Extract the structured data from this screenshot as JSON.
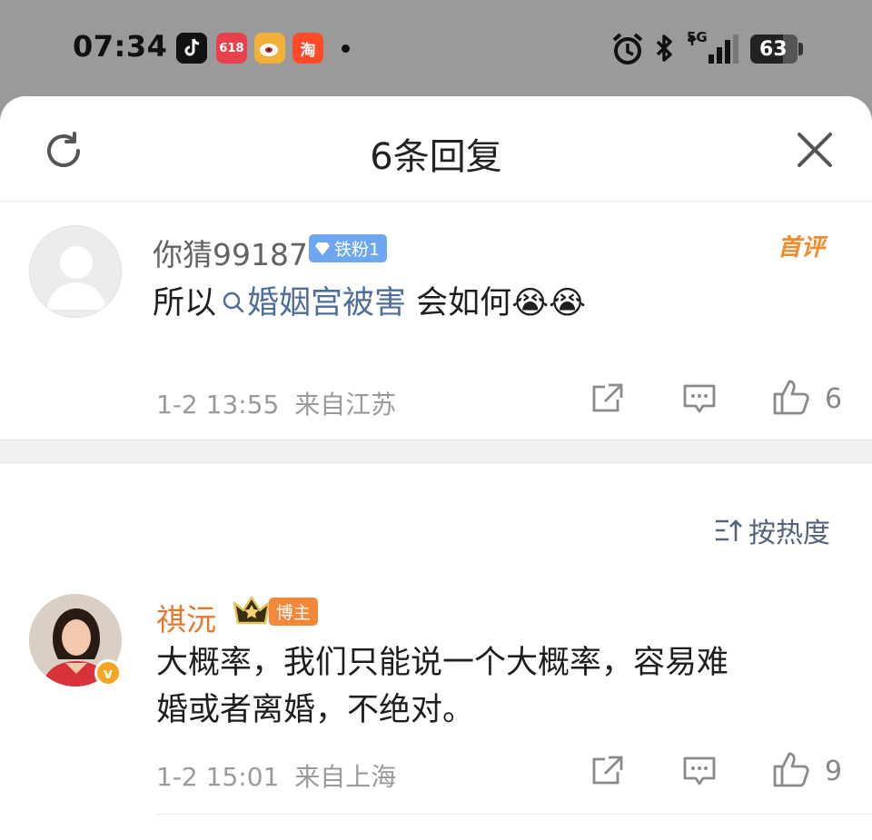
{
  "status_bar": {
    "time": "07:34",
    "apps": [
      {
        "name": "tiktok-icon",
        "label": "♪",
        "color": "#111111"
      },
      {
        "name": "618-app-icon",
        "label": "618",
        "color": "#e8414c"
      },
      {
        "name": "weibo-icon",
        "label": "◉",
        "color": "#f2a43a"
      },
      {
        "name": "taobao-icon",
        "label": "淘",
        "color": "#ff4a2a"
      }
    ],
    "network": "5G",
    "battery": "63"
  },
  "sheet": {
    "title": "6条回复"
  },
  "top_comment": {
    "username": "你猜99187",
    "fan_badge": "铁粉1",
    "first_tag": "首评",
    "text_prefix": "所以",
    "hashtag": "婚姻宫被害",
    "text_suffix": "会如何",
    "emojis": "😭😭",
    "time": "1-2 13:55",
    "location": "来自江苏",
    "likes": "6"
  },
  "sort": {
    "label": "按热度"
  },
  "reply": {
    "username": "祺沅",
    "badge": "博主",
    "text_line1": "大概率，我们只能说一个大概率，容易难",
    "text_line2": "婚或者离婚，不绝对。",
    "time": "1-2 15:01",
    "location": "来自上海",
    "likes": "9"
  },
  "colors": {
    "hashtag": "#4e6e9c",
    "blogger_name": "#e8772e",
    "fan_badge": "#6ea7ef",
    "verified": "#f5a623"
  }
}
